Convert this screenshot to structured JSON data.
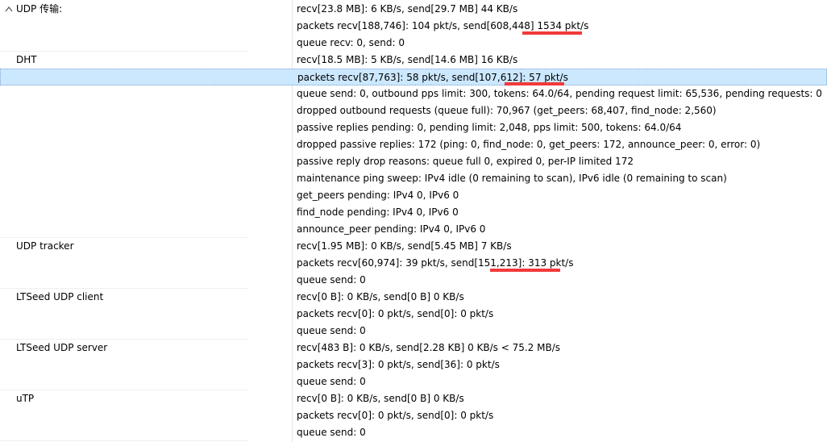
{
  "groups": [
    {
      "name": "UDP 传输:",
      "expanded": true,
      "values": [
        "recv[23.8 MB]: 6 KB/s, send[29.7 MB] 44 KB/s",
        "packets recv[188,746]: 104 pkt/s, send[608,448] 1534 pkt/s",
        "queue recv: 0, send: 0"
      ]
    },
    {
      "name": "DHT",
      "values": [
        "recv[18.5 MB]: 5 KB/s, send[14.6 MB] 16 KB/s",
        "packets recv[87,763]: 58 pkt/s, send[107,612]: 57 pkt/s",
        "queue send: 0, outbound pps limit: 300, tokens: 64.0/64, pending request limit: 65,536, pending requests: 0",
        "dropped outbound requests (queue full): 70,967 (get_peers: 68,407, find_node: 2,560)",
        "passive replies pending: 0, pending limit: 2,048, pps limit: 500, tokens: 64.0/64",
        "dropped passive replies: 172 (ping: 0, find_node: 0, get_peers: 172, announce_peer: 0, error: 0)",
        "passive reply drop reasons: queue full 0, expired 0, per-IP limited 172",
        "maintenance ping sweep: IPv4 idle (0 remaining to scan), IPv6 idle (0 remaining to scan)",
        "get_peers pending: IPv4 0, IPv6 0",
        "find_node pending: IPv4 0, IPv6 0",
        "announce_peer pending: IPv4 0, IPv6 0"
      ]
    },
    {
      "name": "UDP tracker",
      "values": [
        "recv[1.95 MB]: 0 KB/s, send[5.45 MB] 7 KB/s",
        "packets recv[60,974]: 39 pkt/s, send[151,213]: 313 pkt/s",
        "queue send: 0"
      ]
    },
    {
      "name": "LTSeed UDP client",
      "values": [
        "recv[0 B]: 0 KB/s, send[0 B] 0 KB/s",
        "packets recv[0]: 0 pkt/s, send[0]: 0 pkt/s",
        "queue send: 0"
      ]
    },
    {
      "name": "LTSeed UDP server",
      "values": [
        "recv[483 B]: 0 KB/s, send[2.28 KB] 0 KB/s < 75.2 MB/s",
        "packets recv[3]: 0 pkt/s, send[36]: 0 pkt/s",
        "queue send: 0"
      ]
    },
    {
      "name": "uTP",
      "values": [
        "recv[0 B]: 0 KB/s, send[0 B] 0 KB/s",
        "packets recv[0]: 0 pkt/s, send[0]: 0 pkt/s",
        "queue send: 0"
      ]
    }
  ],
  "selected_row": {
    "group": 1,
    "line": 1
  },
  "highlight_color": "#f23a3a",
  "selection_color": "#cce8ff",
  "icons": {
    "expander": "chevron-up-icon"
  }
}
